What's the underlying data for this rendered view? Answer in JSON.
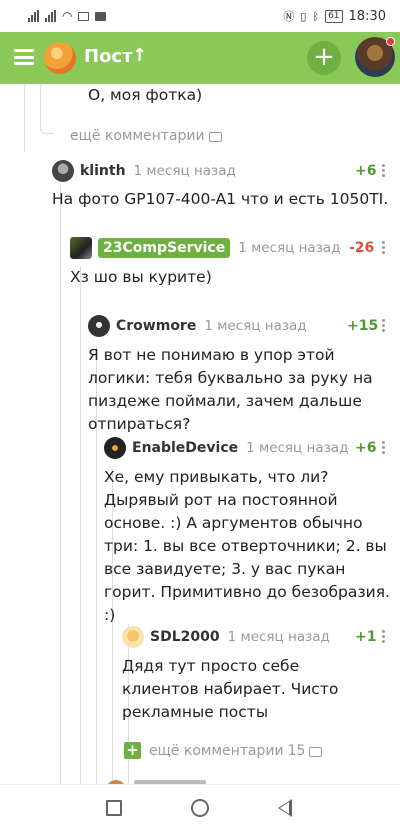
{
  "status_bar": {
    "time": "18:30",
    "battery": "61"
  },
  "app_bar": {
    "title": "Пост",
    "up_arrow": "↑",
    "add_label": "+"
  },
  "comments": [
    {
      "text": "О, моя фотка)"
    },
    {
      "author": "klinth",
      "date": "1 месяц назад",
      "score": "+6",
      "text": "На фото GP107-400-A1 что и есть 1050TI."
    },
    {
      "author": "23CompService",
      "date": "1 месяц назад",
      "score": "-26",
      "text": "Хз шо вы курите)"
    },
    {
      "author": "Crowmore",
      "date": "1 месяц назад",
      "score": "+15",
      "text": "Я вот не понимаю в упор этой логики: тебя буквально за руку на пиздеже поймали, зачем дальше отпираться?"
    },
    {
      "author": "EnableDevice",
      "date": "1 месяц назад",
      "score": "+6",
      "text": "Хе, ему привыкать, что ли? Дырявый рот на постоянной основе. :) А аргументов обычно три: 1. вы все отверточники; 2. вы все завидуете; 3. у вас пукан горит. Примитивно до безобразия. :)"
    },
    {
      "author": "SDL2000",
      "date": "1 месяц назад",
      "score": "+1",
      "text": "Дядя тут просто себе клиентов набирает. Чисто рекламные посты"
    }
  ],
  "more_comments": {
    "label": "ещё комментарии"
  },
  "more_comments_bottom": {
    "label": "ещё комментарии",
    "count": "15",
    "plus": "+"
  },
  "icons": {
    "menu": "hamburger-icon",
    "logo": "app-logo-icon",
    "up": "arrow-up-icon",
    "comment": "comment-bubble-icon",
    "more": "kebab-menu-icon"
  },
  "colors": {
    "accent": "#8ac858",
    "positive": "#4f9a2f",
    "negative": "#d9533b",
    "badge": "#6fb042"
  }
}
